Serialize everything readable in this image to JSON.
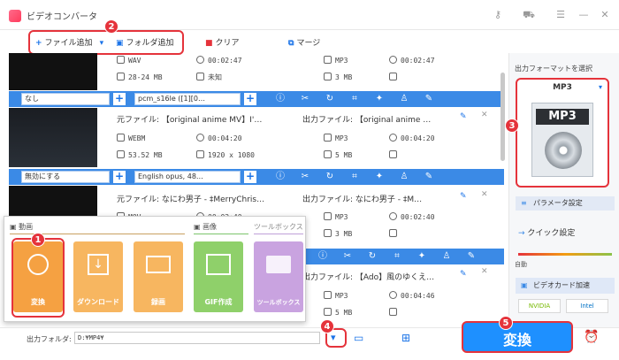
{
  "app": {
    "title": "ビデオコンバータ"
  },
  "toolbar": {
    "add_file": "ファイル追加",
    "add_folder": "フォルダ追加",
    "clear": "クリア",
    "merge": "マージ"
  },
  "rows": [
    {
      "src_format": "WAV",
      "src_duration": "00:02:47",
      "src_size": "28-24 MB",
      "src_res": "未知",
      "out_format": "MP3",
      "out_duration": "00:02:47",
      "out_size": "3 MB",
      "out_res": ""
    },
    {
      "src_name": "元ファイル: 【original anime MV】I'…",
      "src_format": "WEBM",
      "src_duration": "00:04:20",
      "src_size": "53.52 MB",
      "src_res": "1920 x 1080",
      "out_name": "出力ファイル: 【original anime …",
      "out_format": "MP3",
      "out_duration": "00:04:20",
      "out_size": "5 MB",
      "out_res": ""
    },
    {
      "src_name": "元ファイル: なにわ男子 - ‡MerryChris…",
      "src_format": "MOV",
      "src_duration": "00:02:40",
      "out_name": "出力ファイル: なにわ男子 - ‡M…",
      "out_format": "MP3",
      "out_duration": "00:02:40",
      "out_size": "3 MB",
      "out_res": ""
    },
    {
      "out_name": "出力ファイル: 【Ado】風のゆくえ…",
      "out_format": "MP3",
      "out_duration": "00:04:46",
      "out_size": "5 MB",
      "out_res": ""
    }
  ],
  "bars": [
    {
      "subtitle": "なし",
      "audio": "pcm_s16le ([1][0…"
    },
    {
      "subtitle": "無効にする",
      "audio": "English opus, 48…"
    }
  ],
  "popup": {
    "tab_video": "動画",
    "tab_image": "画像",
    "tab_toolbox": "ツールボックス",
    "tiles": [
      "変換",
      "ダウンロード",
      "録画",
      "GIF作成",
      "ツールボックス"
    ]
  },
  "right": {
    "select_label": "出力フォーマットを選択",
    "format": "MP3",
    "param": "パラメータ設定",
    "quick": "クイック設定",
    "auto": "自動",
    "gpu": "ビデオカード加速",
    "nvidia": "NVIDIA",
    "intel": "Intel"
  },
  "bottom": {
    "folder_label": "出力フォルダ:",
    "folder_path": "D:¥MP4¥",
    "convert": "変換"
  },
  "badges": [
    "1",
    "2",
    "3",
    "4",
    "5"
  ],
  "colors": {
    "accent": "#3b8ae6",
    "highlight": "#e5333b",
    "convert": "#1e90ff"
  }
}
